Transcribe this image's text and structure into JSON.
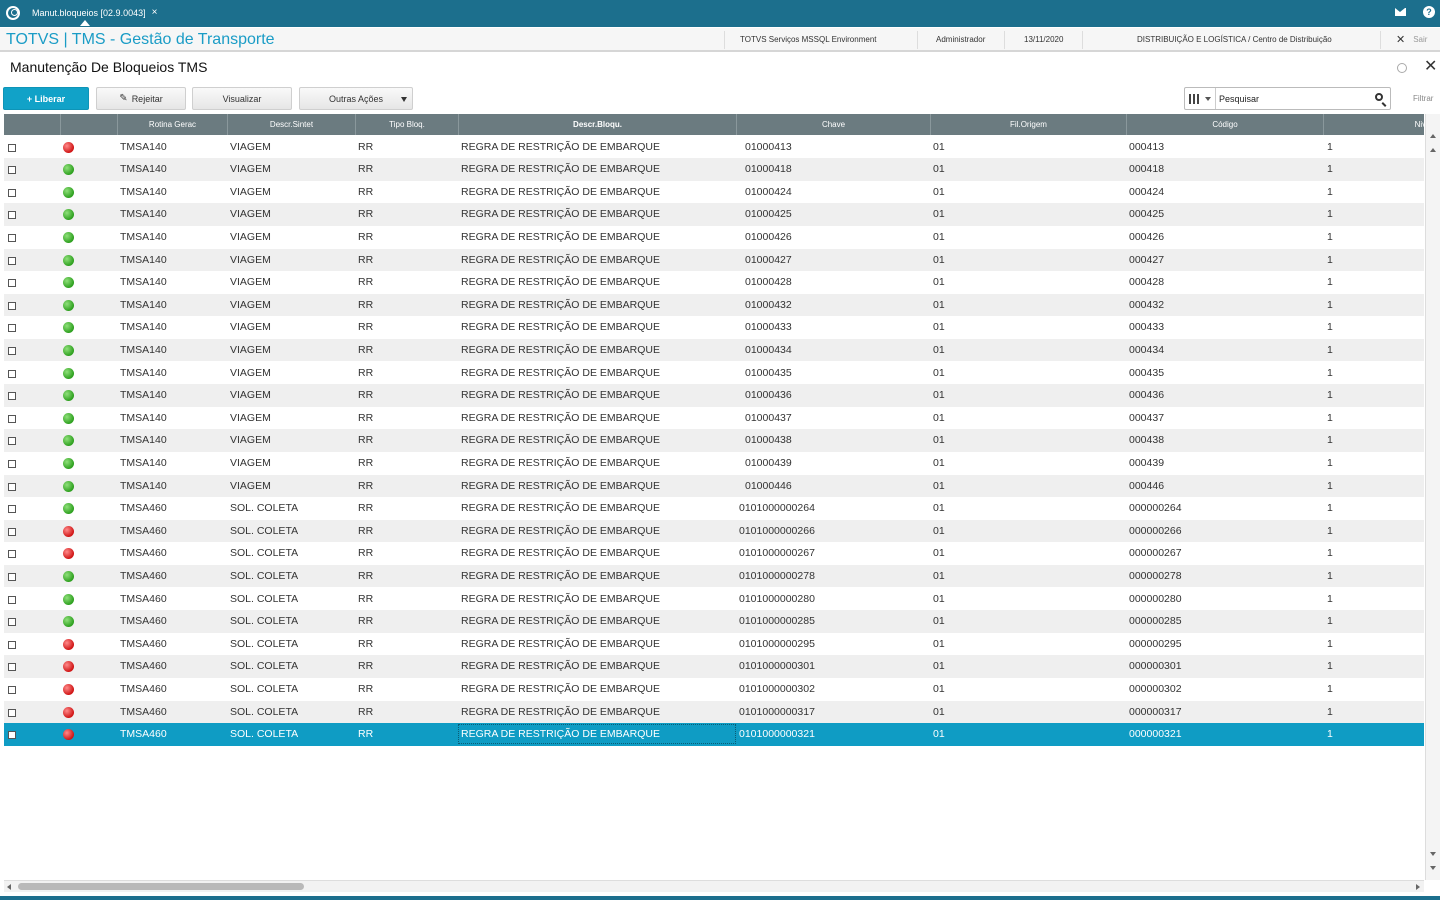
{
  "topbar": {
    "tab_label": "Manut.bloqueios [02.9.0043]",
    "tab_close": "×",
    "help": "?"
  },
  "header": {
    "app_title": "TOTVS | TMS - Gestão de Transporte",
    "environment": "TOTVS Serviços MSSQL Environment",
    "user": "Administrador",
    "date": "13/11/2020",
    "branch": "DISTRIBUIÇÃO E LOGÍSTICA / Centro de Distribuição",
    "exit_label": "Sair"
  },
  "page": {
    "title": "Manutenção De Bloqueios TMS"
  },
  "toolbar": {
    "liberar": "+ Liberar",
    "rejeitar": "Rejeitar",
    "visualizar": "Visualizar",
    "outras": "Outras Ações",
    "search_placeholder": "Pesquisar",
    "filter": "Filtrar"
  },
  "colors": {
    "accent": "#11a2c8",
    "topbar": "#1c6f8d",
    "selected_row": "#0f9cc4",
    "status_green": "#2ea01f",
    "status_red": "#d01515"
  },
  "table": {
    "columns": [
      "",
      "",
      "Rotina Gerac",
      "Descr.Sintet",
      "Tipo Bloq.",
      "Descr.Bloqu.",
      "Chave",
      "Fil.Origem",
      "Código",
      "Nivel B"
    ],
    "rows": [
      {
        "status": "red",
        "rotina": "TMSA140",
        "descr_sint": "VIAGEM",
        "tipo": "RR",
        "descr_bloq": "REGRA DE RESTRIÇÃO DE EMBARQUE",
        "chave": "01000413",
        "fil": "01",
        "codigo": "000413",
        "nivel": "1"
      },
      {
        "status": "green",
        "rotina": "TMSA140",
        "descr_sint": "VIAGEM",
        "tipo": "RR",
        "descr_bloq": "REGRA DE RESTRIÇÃO DE EMBARQUE",
        "chave": "01000418",
        "fil": "01",
        "codigo": "000418",
        "nivel": "1"
      },
      {
        "status": "green",
        "rotina": "TMSA140",
        "descr_sint": "VIAGEM",
        "tipo": "RR",
        "descr_bloq": "REGRA DE RESTRIÇÃO DE EMBARQUE",
        "chave": "01000424",
        "fil": "01",
        "codigo": "000424",
        "nivel": "1"
      },
      {
        "status": "green",
        "rotina": "TMSA140",
        "descr_sint": "VIAGEM",
        "tipo": "RR",
        "descr_bloq": "REGRA DE RESTRIÇÃO DE EMBARQUE",
        "chave": "01000425",
        "fil": "01",
        "codigo": "000425",
        "nivel": "1"
      },
      {
        "status": "green",
        "rotina": "TMSA140",
        "descr_sint": "VIAGEM",
        "tipo": "RR",
        "descr_bloq": "REGRA DE RESTRIÇÃO DE EMBARQUE",
        "chave": "01000426",
        "fil": "01",
        "codigo": "000426",
        "nivel": "1"
      },
      {
        "status": "green",
        "rotina": "TMSA140",
        "descr_sint": "VIAGEM",
        "tipo": "RR",
        "descr_bloq": "REGRA DE RESTRIÇÃO DE EMBARQUE",
        "chave": "01000427",
        "fil": "01",
        "codigo": "000427",
        "nivel": "1"
      },
      {
        "status": "green",
        "rotina": "TMSA140",
        "descr_sint": "VIAGEM",
        "tipo": "RR",
        "descr_bloq": "REGRA DE RESTRIÇÃO DE EMBARQUE",
        "chave": "01000428",
        "fil": "01",
        "codigo": "000428",
        "nivel": "1"
      },
      {
        "status": "green",
        "rotina": "TMSA140",
        "descr_sint": "VIAGEM",
        "tipo": "RR",
        "descr_bloq": "REGRA DE RESTRIÇÃO DE EMBARQUE",
        "chave": "01000432",
        "fil": "01",
        "codigo": "000432",
        "nivel": "1"
      },
      {
        "status": "green",
        "rotina": "TMSA140",
        "descr_sint": "VIAGEM",
        "tipo": "RR",
        "descr_bloq": "REGRA DE RESTRIÇÃO DE EMBARQUE",
        "chave": "01000433",
        "fil": "01",
        "codigo": "000433",
        "nivel": "1"
      },
      {
        "status": "green",
        "rotina": "TMSA140",
        "descr_sint": "VIAGEM",
        "tipo": "RR",
        "descr_bloq": "REGRA DE RESTRIÇÃO DE EMBARQUE",
        "chave": "01000434",
        "fil": "01",
        "codigo": "000434",
        "nivel": "1"
      },
      {
        "status": "green",
        "rotina": "TMSA140",
        "descr_sint": "VIAGEM",
        "tipo": "RR",
        "descr_bloq": "REGRA DE RESTRIÇÃO DE EMBARQUE",
        "chave": "01000435",
        "fil": "01",
        "codigo": "000435",
        "nivel": "1"
      },
      {
        "status": "green",
        "rotina": "TMSA140",
        "descr_sint": "VIAGEM",
        "tipo": "RR",
        "descr_bloq": "REGRA DE RESTRIÇÃO DE EMBARQUE",
        "chave": "01000436",
        "fil": "01",
        "codigo": "000436",
        "nivel": "1"
      },
      {
        "status": "green",
        "rotina": "TMSA140",
        "descr_sint": "VIAGEM",
        "tipo": "RR",
        "descr_bloq": "REGRA DE RESTRIÇÃO DE EMBARQUE",
        "chave": "01000437",
        "fil": "01",
        "codigo": "000437",
        "nivel": "1"
      },
      {
        "status": "green",
        "rotina": "TMSA140",
        "descr_sint": "VIAGEM",
        "tipo": "RR",
        "descr_bloq": "REGRA DE RESTRIÇÃO DE EMBARQUE",
        "chave": "01000438",
        "fil": "01",
        "codigo": "000438",
        "nivel": "1"
      },
      {
        "status": "green",
        "rotina": "TMSA140",
        "descr_sint": "VIAGEM",
        "tipo": "RR",
        "descr_bloq": "REGRA DE RESTRIÇÃO DE EMBARQUE",
        "chave": "01000439",
        "fil": "01",
        "codigo": "000439",
        "nivel": "1"
      },
      {
        "status": "green",
        "rotina": "TMSA140",
        "descr_sint": "VIAGEM",
        "tipo": "RR",
        "descr_bloq": "REGRA DE RESTRIÇÃO DE EMBARQUE",
        "chave": "01000446",
        "fil": "01",
        "codigo": "000446",
        "nivel": "1"
      },
      {
        "status": "green",
        "rotina": "TMSA460",
        "descr_sint": "SOL. COLETA",
        "tipo": "RR",
        "descr_bloq": "REGRA DE RESTRIÇÃO DE EMBARQUE",
        "chave": "0101000000264",
        "fil": "01",
        "codigo": "000000264",
        "nivel": "1"
      },
      {
        "status": "red",
        "rotina": "TMSA460",
        "descr_sint": "SOL. COLETA",
        "tipo": "RR",
        "descr_bloq": "REGRA DE RESTRIÇÃO DE EMBARQUE",
        "chave": "0101000000266",
        "fil": "01",
        "codigo": "000000266",
        "nivel": "1"
      },
      {
        "status": "red",
        "rotina": "TMSA460",
        "descr_sint": "SOL. COLETA",
        "tipo": "RR",
        "descr_bloq": "REGRA DE RESTRIÇÃO DE EMBARQUE",
        "chave": "0101000000267",
        "fil": "01",
        "codigo": "000000267",
        "nivel": "1"
      },
      {
        "status": "green",
        "rotina": "TMSA460",
        "descr_sint": "SOL. COLETA",
        "tipo": "RR",
        "descr_bloq": "REGRA DE RESTRIÇÃO DE EMBARQUE",
        "chave": "0101000000278",
        "fil": "01",
        "codigo": "000000278",
        "nivel": "1"
      },
      {
        "status": "green",
        "rotina": "TMSA460",
        "descr_sint": "SOL. COLETA",
        "tipo": "RR",
        "descr_bloq": "REGRA DE RESTRIÇÃO DE EMBARQUE",
        "chave": "0101000000280",
        "fil": "01",
        "codigo": "000000280",
        "nivel": "1"
      },
      {
        "status": "green",
        "rotina": "TMSA460",
        "descr_sint": "SOL. COLETA",
        "tipo": "RR",
        "descr_bloq": "REGRA DE RESTRIÇÃO DE EMBARQUE",
        "chave": "0101000000285",
        "fil": "01",
        "codigo": "000000285",
        "nivel": "1"
      },
      {
        "status": "red",
        "rotina": "TMSA460",
        "descr_sint": "SOL. COLETA",
        "tipo": "RR",
        "descr_bloq": "REGRA DE RESTRIÇÃO DE EMBARQUE",
        "chave": "0101000000295",
        "fil": "01",
        "codigo": "000000295",
        "nivel": "1"
      },
      {
        "status": "red",
        "rotina": "TMSA460",
        "descr_sint": "SOL. COLETA",
        "tipo": "RR",
        "descr_bloq": "REGRA DE RESTRIÇÃO DE EMBARQUE",
        "chave": "0101000000301",
        "fil": "01",
        "codigo": "000000301",
        "nivel": "1"
      },
      {
        "status": "red",
        "rotina": "TMSA460",
        "descr_sint": "SOL. COLETA",
        "tipo": "RR",
        "descr_bloq": "REGRA DE RESTRIÇÃO DE EMBARQUE",
        "chave": "0101000000302",
        "fil": "01",
        "codigo": "000000302",
        "nivel": "1"
      },
      {
        "status": "red",
        "rotina": "TMSA460",
        "descr_sint": "SOL. COLETA",
        "tipo": "RR",
        "descr_bloq": "REGRA DE RESTRIÇÃO DE EMBARQUE",
        "chave": "0101000000317",
        "fil": "01",
        "codigo": "000000317",
        "nivel": "1"
      },
      {
        "status": "red",
        "rotina": "TMSA460",
        "descr_sint": "SOL. COLETA",
        "tipo": "RR",
        "descr_bloq": "REGRA DE RESTRIÇÃO DE EMBARQUE",
        "chave": "0101000000321",
        "fil": "01",
        "codigo": "000000321",
        "nivel": "1",
        "selected": true
      }
    ]
  }
}
